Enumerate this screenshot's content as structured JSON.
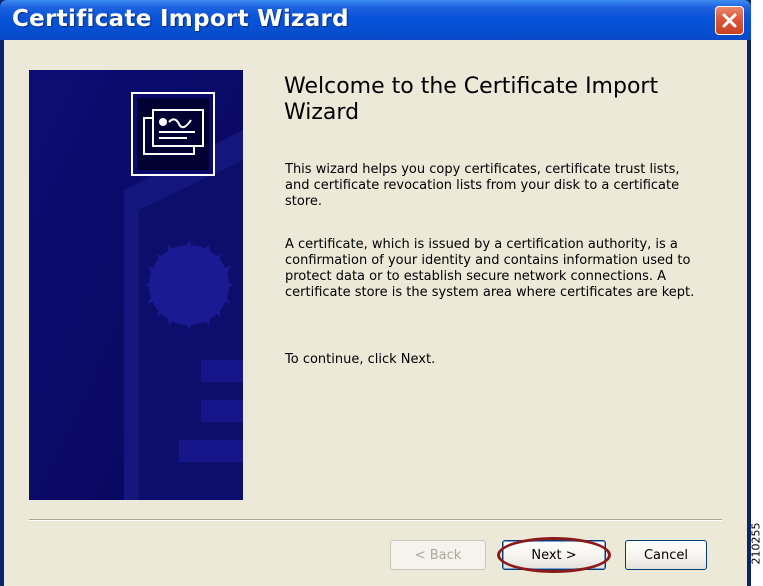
{
  "window": {
    "title": "Certificate Import Wizard"
  },
  "content": {
    "heading": "Welcome to the Certificate Import Wizard",
    "paragraphs": [
      "This wizard helps you copy certificates, certificate trust lists, and certificate revocation lists from your disk to a certificate store.",
      "A certificate, which is issued by a certification authority, is a confirmation of your identity and contains information used to protect data or to establish secure network connections. A certificate store is the system area where certificates are kept.",
      "To continue, click Next."
    ]
  },
  "buttons": {
    "back": "< Back",
    "next": "Next >",
    "cancel": "Cancel"
  },
  "figure_id": "210255",
  "icons": {
    "close": "close-icon",
    "banner": "certificate-icon"
  },
  "colors": {
    "titlebar": "#0853d8",
    "side_panel": "#0a0a6b",
    "client": "#ece9d8",
    "highlight": "#8b1a1a"
  }
}
